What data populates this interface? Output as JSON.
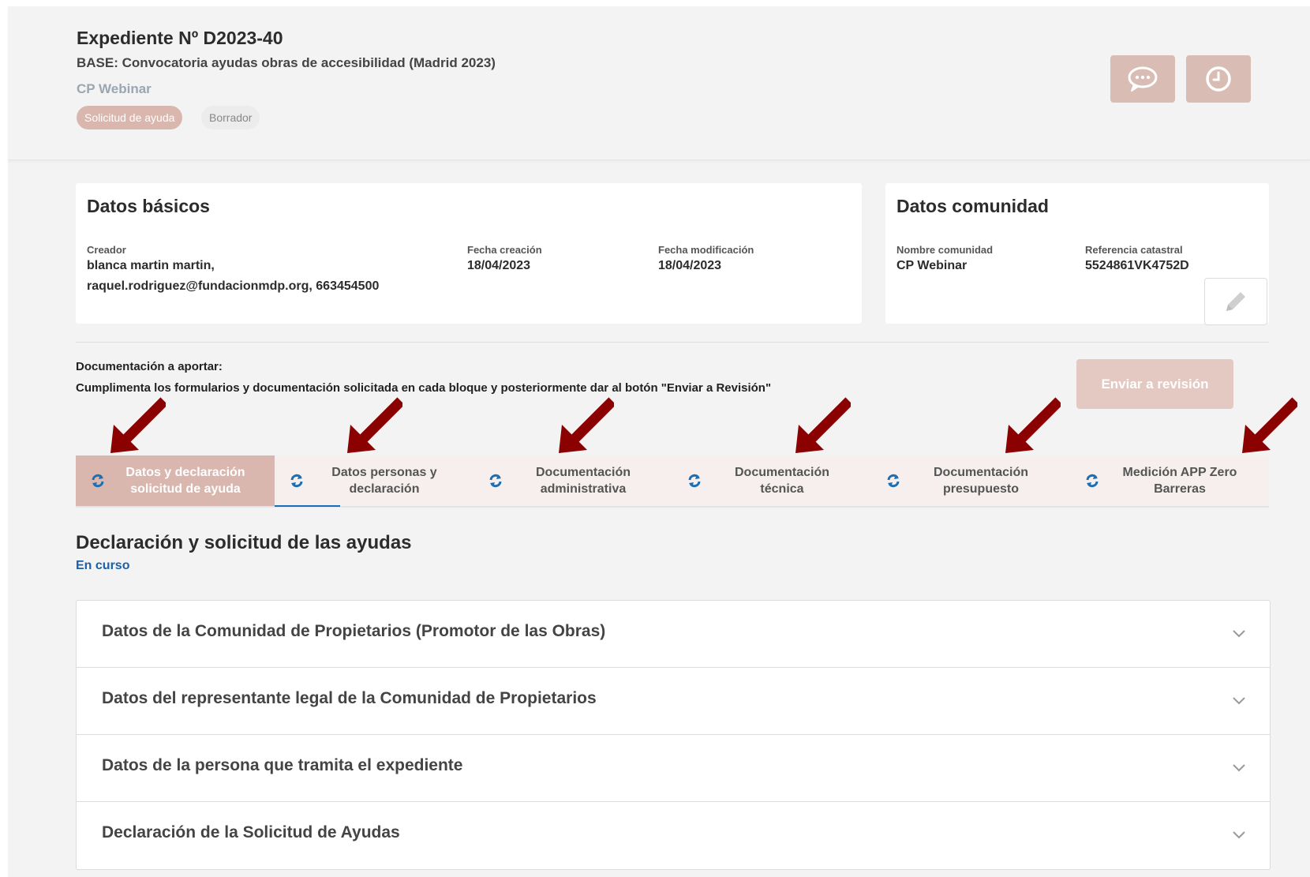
{
  "header": {
    "title": "Expediente Nº D2023-40",
    "subtitle": "BASE: Convocatoria ayudas obras de accesibilidad (Madrid 2023)",
    "community": "CP Webinar",
    "badges": [
      "Solicitud de ayuda",
      "Borrador"
    ],
    "buttons": [
      {
        "icon": "chat-bubble-icon"
      },
      {
        "icon": "clock-icon"
      }
    ]
  },
  "basic": {
    "title": "Datos básicos",
    "creator_label": "Creador",
    "creator_line1": "blanca martin martin,",
    "creator_line2": "raquel.rodriguez@fundacionmdp.org, 663454500",
    "created_label": "Fecha creación",
    "created_value": "18/04/2023",
    "modified_label": "Fecha modificación",
    "modified_value": "18/04/2023"
  },
  "community": {
    "title": "Datos comunidad",
    "name_label": "Nombre comunidad",
    "name_value": "CP Webinar",
    "cadastral_label": "Referencia catastral",
    "cadastral_value": "5524861VK4752D",
    "edit_icon": "pencil-icon"
  },
  "docs": {
    "label": "Documentación a aportar:",
    "instructions": "Cumplimenta los formularios y documentación solicitada en cada bloque y posteriormente dar al botón \"Enviar a Revisión\"",
    "send_button": "Enviar a revisión"
  },
  "tabs": [
    {
      "label": "Datos y declaración solicitud de ayuda",
      "active": true
    },
    {
      "label": "Datos personas y declaración",
      "active": false
    },
    {
      "label": "Documentación administrativa",
      "active": false
    },
    {
      "label": "Documentación técnica",
      "active": false
    },
    {
      "label": "Documentación presupuesto",
      "active": false
    },
    {
      "label": "Medición APP Zero Barreras",
      "active": false
    }
  ],
  "section": {
    "title": "Declaración y solicitud de las ayudas",
    "status": "En curso"
  },
  "accordion": [
    "Datos de la Comunidad de Propietarios (Promotor de las Obras)",
    "Datos del representante legal de la Comunidad de Propietarios",
    "Datos de la persona que tramita el expediente",
    "Declaración de la Solicitud de Ayudas"
  ],
  "colors": {
    "accent": "#d9b7ae",
    "arrow": "#8b0000",
    "link": "#1d5fa8",
    "refresh_icon": "#1d6fb5"
  }
}
